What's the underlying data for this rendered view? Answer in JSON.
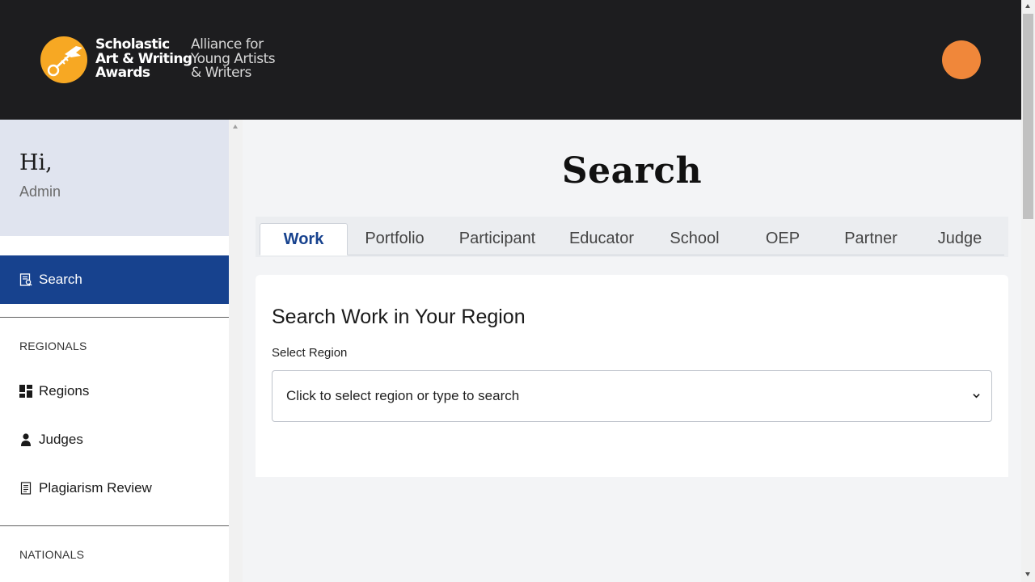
{
  "header": {
    "logo_line1": "Scholastic",
    "logo_line2": "Art & Writing",
    "logo_line3": "Awards",
    "logo_sub1": "Alliance for",
    "logo_sub2": "Young Artists",
    "logo_sub3": "& Writers",
    "brand_color": "#f7a823",
    "avatar_color": "#f0873a"
  },
  "sidebar": {
    "greeting": "Hi,",
    "user_name": "Admin",
    "active_item": "Search",
    "sections": [
      {
        "label": "REGIONALS",
        "items": [
          {
            "label": "Regions",
            "icon": "grid-icon"
          },
          {
            "label": "Judges",
            "icon": "person-icon"
          },
          {
            "label": "Plagiarism Review",
            "icon": "document-icon"
          }
        ]
      },
      {
        "label": "NATIONALS",
        "items": []
      }
    ],
    "active_color": "#17428e"
  },
  "main": {
    "title": "Search",
    "tabs": [
      {
        "label": "Work",
        "active": true
      },
      {
        "label": "Portfolio"
      },
      {
        "label": "Participant"
      },
      {
        "label": "Educator"
      },
      {
        "label": "School"
      },
      {
        "label": "OEP"
      },
      {
        "label": "Partner"
      },
      {
        "label": "Judge"
      }
    ],
    "card_title": "Search Work in Your Region",
    "region_label": "Select Region",
    "region_placeholder": "Click to select region or type to search"
  }
}
